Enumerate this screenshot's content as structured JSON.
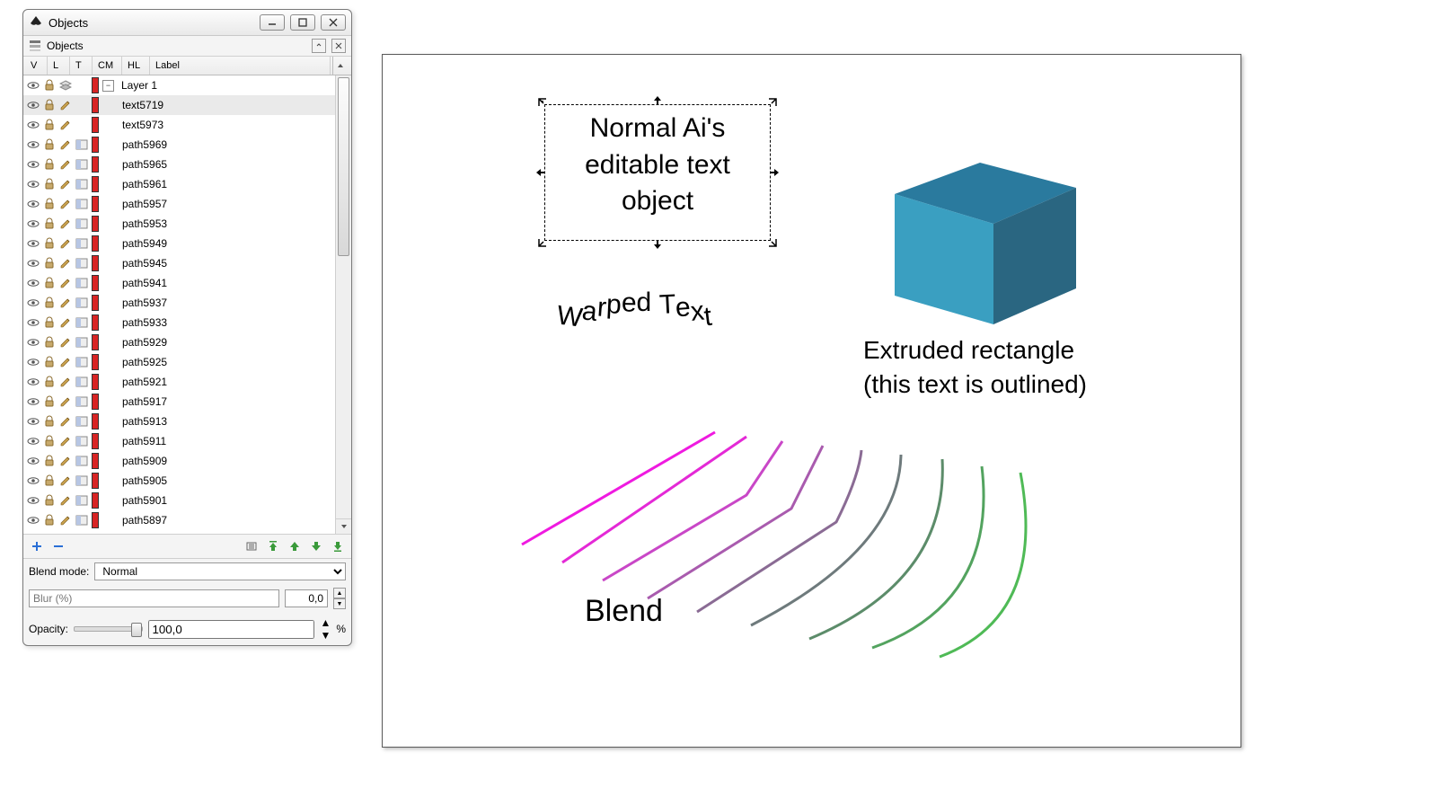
{
  "window": {
    "title": "Objects"
  },
  "panel": {
    "title": "Objects",
    "columns": {
      "v": "V",
      "l": "L",
      "t": "T",
      "cm": "CM",
      "hl": "HL",
      "label": "Label"
    },
    "layer_name": "Layer 1",
    "items": [
      {
        "label": "text5719",
        "selected": true,
        "type_icon": "pencil"
      },
      {
        "label": "text5973",
        "selected": false,
        "type_icon": "pencil"
      },
      {
        "label": "path5969",
        "selected": false,
        "type_icon": "pencil"
      },
      {
        "label": "path5965",
        "selected": false,
        "type_icon": "pencil"
      },
      {
        "label": "path5961",
        "selected": false,
        "type_icon": "pencil"
      },
      {
        "label": "path5957",
        "selected": false,
        "type_icon": "pencil"
      },
      {
        "label": "path5953",
        "selected": false,
        "type_icon": "pencil"
      },
      {
        "label": "path5949",
        "selected": false,
        "type_icon": "pencil"
      },
      {
        "label": "path5945",
        "selected": false,
        "type_icon": "pencil"
      },
      {
        "label": "path5941",
        "selected": false,
        "type_icon": "pencil"
      },
      {
        "label": "path5937",
        "selected": false,
        "type_icon": "pencil"
      },
      {
        "label": "path5933",
        "selected": false,
        "type_icon": "pencil"
      },
      {
        "label": "path5929",
        "selected": false,
        "type_icon": "pencil"
      },
      {
        "label": "path5925",
        "selected": false,
        "type_icon": "pencil"
      },
      {
        "label": "path5921",
        "selected": false,
        "type_icon": "pencil"
      },
      {
        "label": "path5917",
        "selected": false,
        "type_icon": "pencil"
      },
      {
        "label": "path5913",
        "selected": false,
        "type_icon": "pencil"
      },
      {
        "label": "path5911",
        "selected": false,
        "type_icon": "pencil"
      },
      {
        "label": "path5909",
        "selected": false,
        "type_icon": "pencil"
      },
      {
        "label": "path5905",
        "selected": false,
        "type_icon": "pencil"
      },
      {
        "label": "path5901",
        "selected": false,
        "type_icon": "pencil"
      },
      {
        "label": "path5897",
        "selected": false,
        "type_icon": "pencil"
      }
    ],
    "blend_mode_label": "Blend mode:",
    "blend_mode_value": "Normal",
    "blur_label": "Blur (%)",
    "blur_value": "0,0",
    "opacity_label": "Opacity:",
    "opacity_value": "100,0",
    "opacity_percent_glyph": "%"
  },
  "artwork": {
    "selected_text": "Normal Ai's\neditable text\nobject",
    "warped_text": "Warped Text",
    "extruded_label": "Extruded rectangle\n(this text is outlined)",
    "blend_label": "Blend",
    "cube_colors": {
      "top": "#2a7a9e",
      "front": "#3a9fc1",
      "side": "#2a6681"
    },
    "blend_stroke_colors": [
      "#ef1ae0",
      "#e429d6",
      "#c947c7",
      "#a95bae",
      "#8a6b94",
      "#6e7a7c",
      "#5c8c6a",
      "#53a35f",
      "#4fba56"
    ]
  }
}
